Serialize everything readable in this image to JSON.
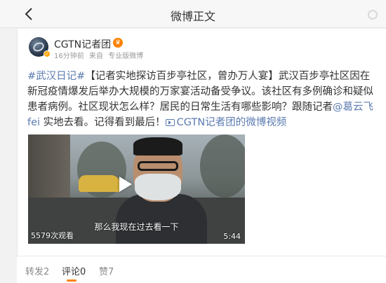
{
  "header": {
    "title": "微博正文"
  },
  "post": {
    "user_name": "CGTN记者团",
    "time": "16分钟前",
    "source_prefix": "来自",
    "source": "专业版微博",
    "hashtag": "#武汉日记#",
    "headline": "【记者实地探访百步亭社区，曾办万人宴】",
    "body_part1": "武汉百步亭社区因在新冠疫情爆发后举办大规模的万家宴活动备受争议。该社区有多例确诊和疑似患者病例。社区现状怎么样？居民的日常生活有哪些影响？跟随记者",
    "mention": "@葛云飞fei",
    "body_part2": " 实地去看。记得看到最后！",
    "video_link_text": "CGTN记者团的微博视频"
  },
  "video": {
    "view_count": "5579次观看",
    "subtitle": "那么我现在过去看一下",
    "duration": "5:44"
  },
  "tabs": [
    {
      "label": "转发2"
    },
    {
      "label": "评论0"
    },
    {
      "label": "赞7"
    }
  ],
  "colors": {
    "link": "#5b7bb1",
    "accent": "#ff8200"
  }
}
